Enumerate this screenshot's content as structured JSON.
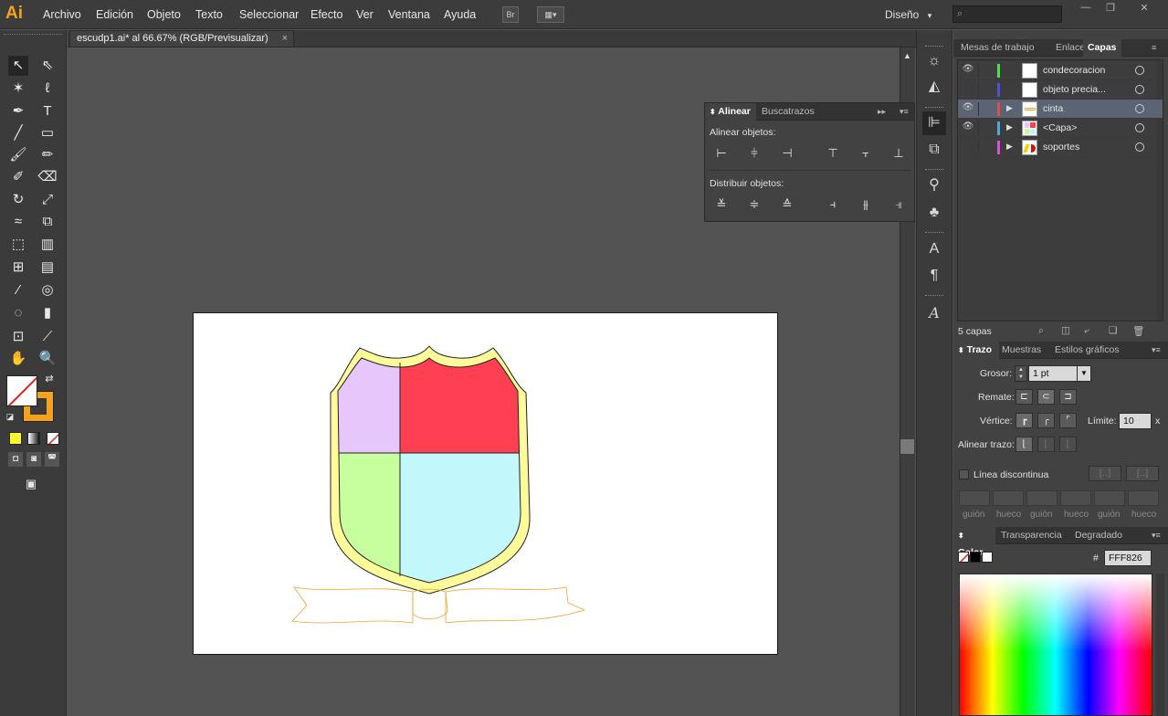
{
  "app": {
    "logo": "Ai"
  },
  "menu": [
    "Archivo",
    "Edición",
    "Objeto",
    "Texto",
    "Seleccionar",
    "Efecto",
    "Ver",
    "Ventana",
    "Ayuda"
  ],
  "toolbar_buttons": {
    "bridge": "Br"
  },
  "workspace": {
    "label": "Diseño",
    "arrow": "▾"
  },
  "window_buttons": {
    "minimize": "—",
    "restore": "❐",
    "close": "✕"
  },
  "document": {
    "tab_title": "escudp1.ai* al 66.67% (RGB/Previsualizar)",
    "close": "×"
  },
  "align_panel": {
    "tabs": [
      "Alinear",
      "Buscatrazos"
    ],
    "align_objects_label": "Alinear objetos:",
    "distribute_objects_label": "Distribuir objetos:"
  },
  "right_tabs_top": [
    "Mesas de trabajo",
    "Enlaces",
    "Capas"
  ],
  "layers": [
    {
      "name": "condecoracion",
      "visible": true,
      "color": "#4fdc4f",
      "expandable": false,
      "thumb": "white"
    },
    {
      "name": "objeto precia...",
      "visible": false,
      "color": "#4f4fdc",
      "expandable": false,
      "thumb": "white"
    },
    {
      "name": "cinta",
      "visible": true,
      "color": "#dc4f4f",
      "expandable": true,
      "thumb": "ribbon",
      "selected": true
    },
    {
      "name": "<Capa>",
      "visible": true,
      "color": "#4fa8dc",
      "expandable": true,
      "thumb": "shield"
    },
    {
      "name": "soportes",
      "visible": false,
      "color": "#dc4fdc",
      "expandable": true,
      "thumb": "soportes"
    }
  ],
  "layers_footer": {
    "count": "5 capas"
  },
  "stroke_tabs": [
    "Trazo",
    "Muestras",
    "Estilos gráficos"
  ],
  "stroke": {
    "weight_label": "Grosor:",
    "weight_value": "1 pt",
    "cap_label": "Remate:",
    "corner_label": "Vértice:",
    "limit_label": "Límite:",
    "limit_value": "10",
    "limit_unit": "x",
    "align_label": "Alinear trazo:",
    "dashed_label": "Línea discontinua",
    "dash_labels": [
      "guión",
      "hueco",
      "guión",
      "hueco",
      "guión",
      "hueco"
    ]
  },
  "color_tabs": [
    "Color",
    "Transparencia",
    "Degradado"
  ],
  "color": {
    "hash": "#",
    "hex_value": "FFF826"
  },
  "colors": {
    "accent": "#f7a21b",
    "shield_outer": "#fffa9a",
    "q_top_left": "#e7c6fb",
    "q_top_right": "#ff4052",
    "q_bottom_left": "#c7ff9e",
    "q_bottom_right": "#c2f7fb",
    "ribbon_stroke": "#f0a030"
  }
}
